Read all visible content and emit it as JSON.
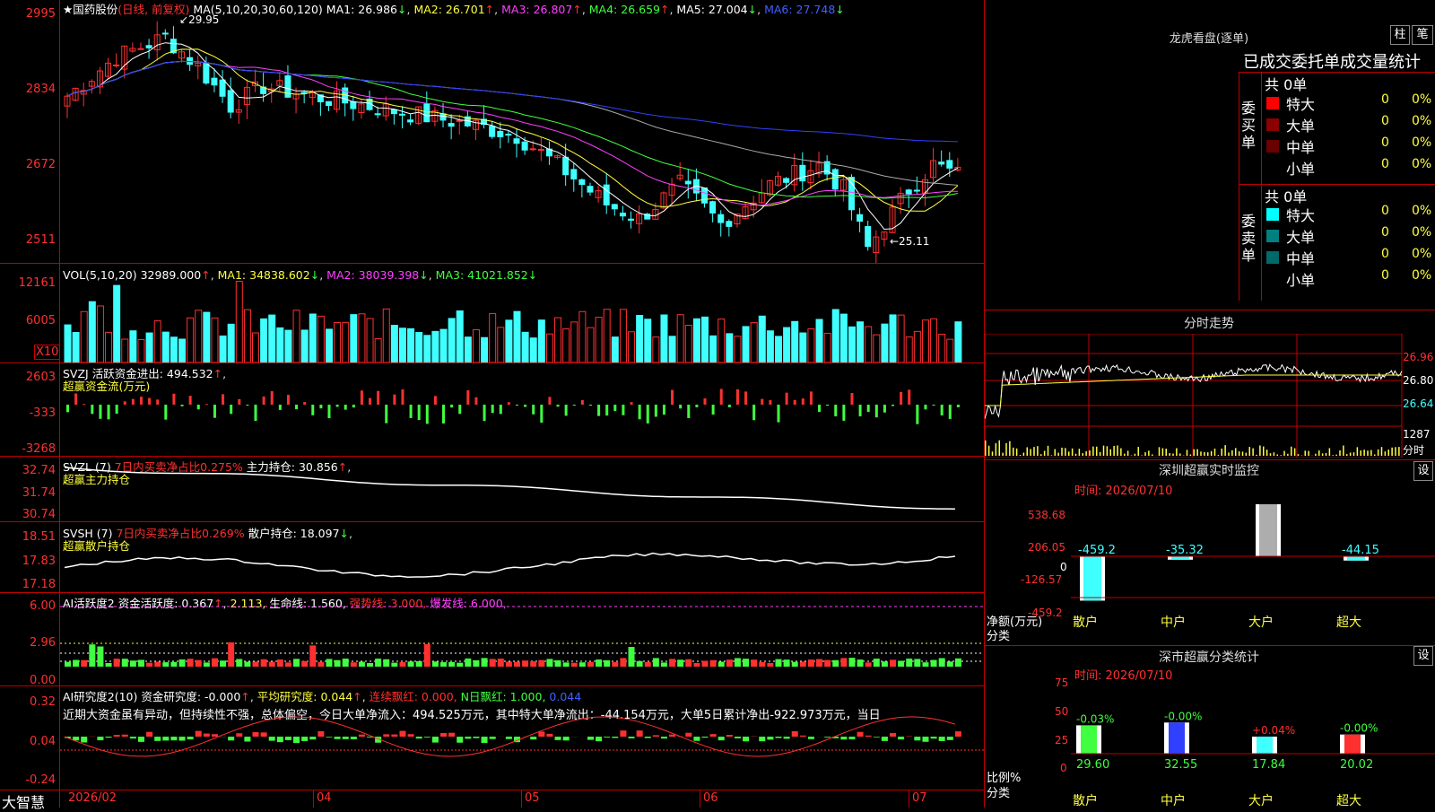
{
  "app": {
    "name": "大智慧"
  },
  "main_chart": {
    "title": "★国药股份",
    "period": "(日线, 前复权)",
    "ma_header": "MA(5,10,20,30,60,120)",
    "ma1": "MA1: 26.986",
    "ma2": "MA2: 26.701",
    "ma3": "MA3: 26.807",
    "ma4": "MA4: 26.659",
    "ma5": "MA5: 27.004",
    "ma6": "MA6: 27.748",
    "y_ticks": [
      "2995",
      "2834",
      "2672",
      "2511"
    ],
    "high_label": "29.95",
    "low_label": "←25.11",
    "chart_data": {
      "type": "candlestick",
      "y_range": [
        25.11,
        29.95
      ],
      "note_high": 29.95,
      "note_low": 25.11
    }
  },
  "vol_panel": {
    "header": "VOL(5,10,20)",
    "value": "32989.000",
    "ma1": "MA1: 34838.602",
    "ma2": "MA2: 38039.398",
    "ma3": "MA3: 41021.852",
    "y_ticks": [
      "12161",
      "6005"
    ],
    "unit": "X10"
  },
  "svzj_panel": {
    "header": "SVZJ",
    "label": "活跃资金进出: 494.532",
    "sub": "超赢资金流(万元)",
    "y_ticks": [
      "2603",
      "-333",
      "-3268"
    ]
  },
  "svzl_panel": {
    "header": "SVZL (7)",
    "ratio": "7日内买卖净占比0.275%",
    "main": "主力持仓: 30.856",
    "sub": "超赢主力持仓",
    "y_ticks": [
      "32.74",
      "31.74",
      "30.74"
    ]
  },
  "svsh_panel": {
    "header": "SVSH (7)",
    "ratio": "7日内买卖净占比0.269%",
    "main": "散户持仓: 18.097",
    "sub": "超赢散户持仓",
    "y_ticks": [
      "18.51",
      "17.83",
      "17.18"
    ]
  },
  "ai_active_panel": {
    "header": "AI活跃度2",
    "a": "资金活跃度: 0.367",
    "b": "2.113,",
    "c": "生命线: 1.560,",
    "d": "强势线: 3.000,",
    "e": "爆发线: 6.000,",
    "y_ticks": [
      "6.00",
      "2.96",
      "0.00"
    ]
  },
  "ai_research_panel": {
    "header": "AI研究度2(10)",
    "a": "资金研究度: -0.000",
    "b": "平均研究度: 0.044",
    "c": "连续飘红: 0.000,",
    "d": "N日飘红: 1.000,",
    "e": "0.044",
    "comment": "近期大资金虽有异动，但持续性不强，总体偏空，今日大单净流入：494.525万元，其中特大单净流出：-44.154万元，大单5日累计净出-922.973万元，当日",
    "y_ticks": [
      "0.32",
      "0.04",
      "-0.24"
    ]
  },
  "x_axis": {
    "labels": [
      "2026/02",
      "04",
      "05",
      "06",
      "07"
    ]
  },
  "right": {
    "lhb_title": "龙虎看盘(逐单)",
    "btn_zhu": "柱",
    "btn_bi": "笔",
    "stat_title": "已成交委托单成交量统计",
    "buy_side": "委买单",
    "sell_side": "委卖单",
    "buy_total": "共 0单",
    "sell_total": "共 0单",
    "buy_rows": [
      {
        "name": "特大",
        "count": "0",
        "pct": "0%",
        "color": "#ff0000"
      },
      {
        "name": "大单",
        "count": "0",
        "pct": "0%",
        "color": "#8b0000"
      },
      {
        "name": "中单",
        "count": "0",
        "pct": "0%",
        "color": "#6b0000"
      },
      {
        "name": "小单",
        "count": "0",
        "pct": "0%",
        "color": "#000000"
      }
    ],
    "sell_rows": [
      {
        "name": "特大",
        "count": "0",
        "pct": "0%",
        "color": "#00ffff"
      },
      {
        "name": "大单",
        "count": "0",
        "pct": "0%",
        "color": "#008080"
      },
      {
        "name": "中单",
        "count": "0",
        "pct": "0%",
        "color": "#006a6a"
      },
      {
        "name": "小单",
        "count": "0",
        "pct": "0%",
        "color": "#000000"
      }
    ],
    "intraday_title": "分时走势",
    "intraday_ticks": [
      "26.96",
      "26.80",
      "26.64",
      "1287"
    ],
    "intraday_vol_unit": "分时",
    "sz_monitor_title": "深圳超赢实时监控",
    "sz_btn": "设",
    "sz_time": "时间: 2026/07/10",
    "sz_y": [
      "538.68",
      "206.05",
      "0",
      "-126.57",
      "-459.2"
    ],
    "sz_unit": "净额(万元)",
    "sz_cat": "分类",
    "sz_chart_data": {
      "type": "bar",
      "categories": [
        "散户",
        "中户",
        "大户",
        "超大"
      ],
      "values": [
        -459.2,
        -35.32,
        538.68,
        -44.15
      ],
      "labels": [
        "-459.2",
        "-35.32",
        "538.68",
        "-44.15"
      ]
    },
    "sz_stat_title": "深市超赢分类统计",
    "sz_stat_btn": "设",
    "sz_stat_time": "时间: 2026/07/10",
    "sz_stat_y": [
      "75",
      "50",
      "25",
      "0"
    ],
    "sz_stat_unit": "比例%",
    "sz_stat_cat": "分类",
    "sz_stat_chart_data": {
      "type": "bar",
      "categories": [
        "散户",
        "中户",
        "大户",
        "超大"
      ],
      "values": [
        29.6,
        32.55,
        17.84,
        20.02
      ],
      "labels": [
        "29.60",
        "32.55",
        "17.84",
        "20.02"
      ],
      "changes": [
        "-0.03%",
        "-0.00%",
        "+0.04%",
        "-0.00%"
      ]
    }
  }
}
